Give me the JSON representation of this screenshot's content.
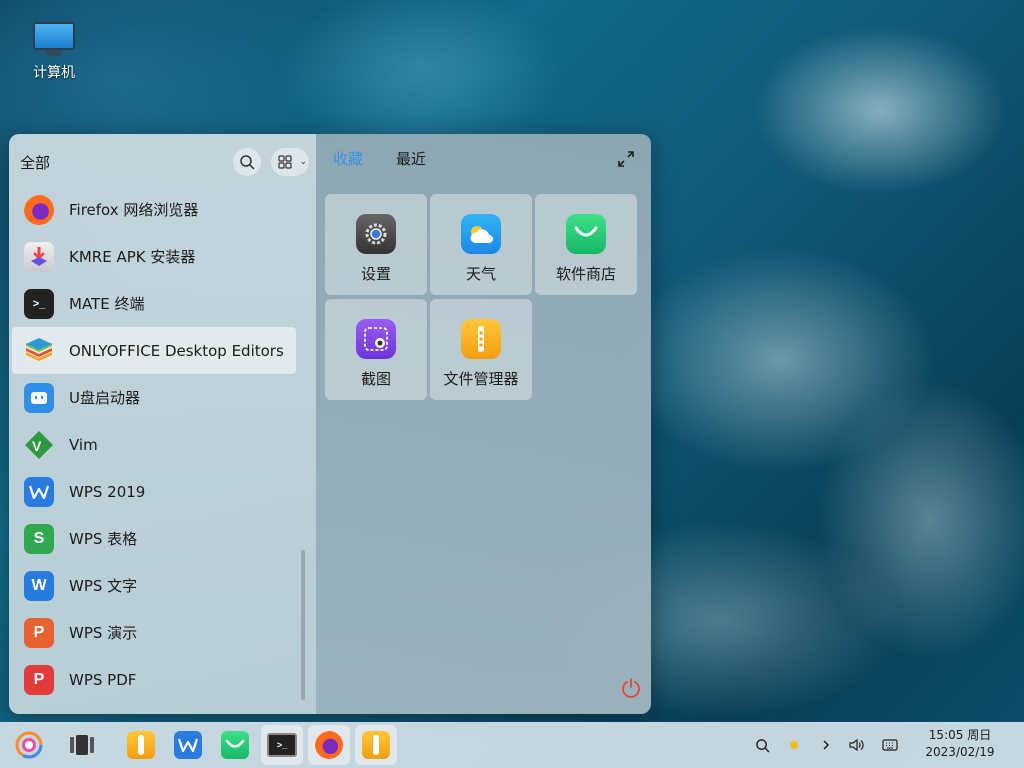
{
  "desktop": {
    "icons": [
      {
        "label": "计算机",
        "icon": "computer-icon"
      }
    ]
  },
  "start_menu": {
    "left": {
      "title": "全部",
      "apps": [
        {
          "label": "Firefox 网络浏览器",
          "icon": "firefox-icon"
        },
        {
          "label": "KMRE APK 安装器",
          "icon": "apk-installer-icon"
        },
        {
          "label": "MATE 终端",
          "icon": "terminal-icon"
        },
        {
          "label": "ONLYOFFICE Desktop Editors",
          "icon": "onlyoffice-icon",
          "selected": true
        },
        {
          "label": "U盘启动器",
          "icon": "usb-boot-icon"
        },
        {
          "label": "Vim",
          "icon": "vim-icon"
        },
        {
          "label": "WPS 2019",
          "icon": "wps-icon"
        },
        {
          "label": "WPS 表格",
          "icon": "wps-spreadsheet-icon"
        },
        {
          "label": "WPS 文字",
          "icon": "wps-writer-icon"
        },
        {
          "label": "WPS 演示",
          "icon": "wps-presentation-icon"
        },
        {
          "label": "WPS PDF",
          "icon": "wps-pdf-icon"
        }
      ]
    },
    "right": {
      "tabs": [
        {
          "label": "收藏",
          "active": true
        },
        {
          "label": "最近",
          "active": false
        }
      ],
      "favorites": [
        {
          "label": "设置",
          "icon": "settings-icon"
        },
        {
          "label": "天气",
          "icon": "weather-icon"
        },
        {
          "label": "软件商店",
          "icon": "software-store-icon"
        },
        {
          "label": "截图",
          "icon": "screenshot-icon"
        },
        {
          "label": "文件管理器",
          "icon": "file-manager-icon"
        }
      ]
    }
  },
  "taskbar": {
    "items": [
      {
        "name": "start-menu-button",
        "icon": "kylin-logo-icon",
        "active": false
      },
      {
        "name": "multitask-view-button",
        "icon": "multitask-icon",
        "active": false
      },
      {
        "name": "file-manager-taskbar-button",
        "icon": "file-manager-icon",
        "active": false
      },
      {
        "name": "wps-taskbar-button",
        "icon": "wps-icon",
        "active": false
      },
      {
        "name": "software-store-taskbar-button",
        "icon": "software-store-icon",
        "active": false
      },
      {
        "name": "terminal-taskbar-button",
        "icon": "terminal-icon",
        "active": true
      },
      {
        "name": "firefox-taskbar-button",
        "icon": "firefox-icon",
        "active": true
      },
      {
        "name": "file-manager-window-button",
        "icon": "file-manager-icon",
        "active": true
      }
    ],
    "tray": [
      "search-icon",
      "night-mode-icon",
      "expand-tray-icon",
      "volume-icon",
      "keyboard-icon"
    ],
    "clock": {
      "time": "15:05 周日",
      "date": "2023/02/19"
    }
  },
  "colors": {
    "accent": "#3a8ee6",
    "power": "#e0483b",
    "wps_blue": "#2a7bde",
    "wps_green": "#2fa84f",
    "wps_orange": "#e8622f",
    "wps_red": "#e23b3b"
  }
}
